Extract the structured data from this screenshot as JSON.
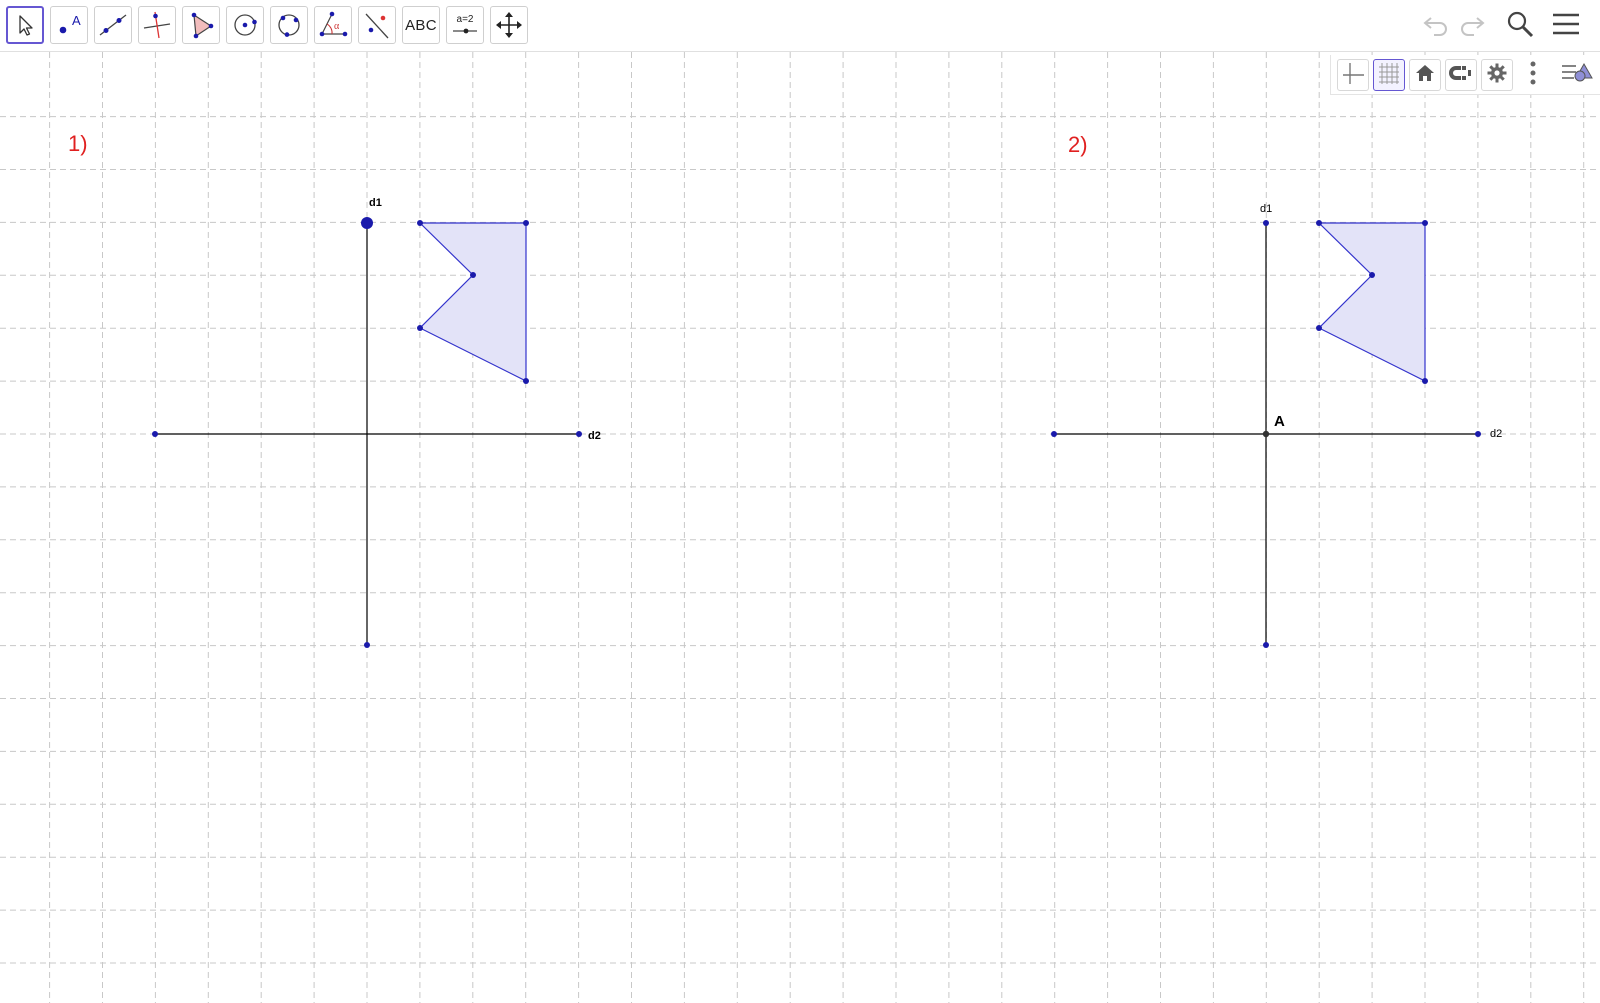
{
  "toolbar": {
    "tools": [
      {
        "id": "move",
        "icon": "move-arrow-icon"
      },
      {
        "id": "point",
        "icon": "point-icon",
        "glyph": "A"
      },
      {
        "id": "line",
        "icon": "line-through-two-points-icon"
      },
      {
        "id": "perpendicular",
        "icon": "perpendicular-line-icon"
      },
      {
        "id": "polygon",
        "icon": "polygon-icon"
      },
      {
        "id": "circle",
        "icon": "circle-center-point-icon"
      },
      {
        "id": "circle3",
        "icon": "circle-three-points-icon"
      },
      {
        "id": "angle",
        "icon": "angle-icon",
        "glyph": "α"
      },
      {
        "id": "reflect",
        "icon": "reflect-about-line-icon"
      },
      {
        "id": "text",
        "icon": "text-icon",
        "label": "ABC"
      },
      {
        "id": "slider",
        "icon": "slider-icon",
        "label": "a=2"
      },
      {
        "id": "move-graphics",
        "icon": "move-graphics-view-icon"
      }
    ],
    "right": [
      "undo-icon",
      "redo-icon",
      "search-icon",
      "hamburger-menu-icon"
    ]
  },
  "style_bar": [
    "axes-icon",
    "grid-icon",
    "home-icon",
    "point-capturing-icon",
    "gear-icon",
    "more-vertical-icon",
    "style-bar-toggle-icon"
  ],
  "colors": {
    "grid": "#c8c8c8",
    "axis": "#000000",
    "point": "#1a1aab",
    "polygon_fill": "#e3e3f8",
    "polygon_stroke": "#3333cc",
    "label_red": "#e02020",
    "selected_border": "#6557d2"
  },
  "graphics": {
    "figure1": {
      "label": "1)",
      "d1_label": "d1",
      "d2_label": "d2"
    },
    "figure2": {
      "label": "2)",
      "d1_label": "d1",
      "d2_label": "d2",
      "point_label": "A"
    }
  }
}
